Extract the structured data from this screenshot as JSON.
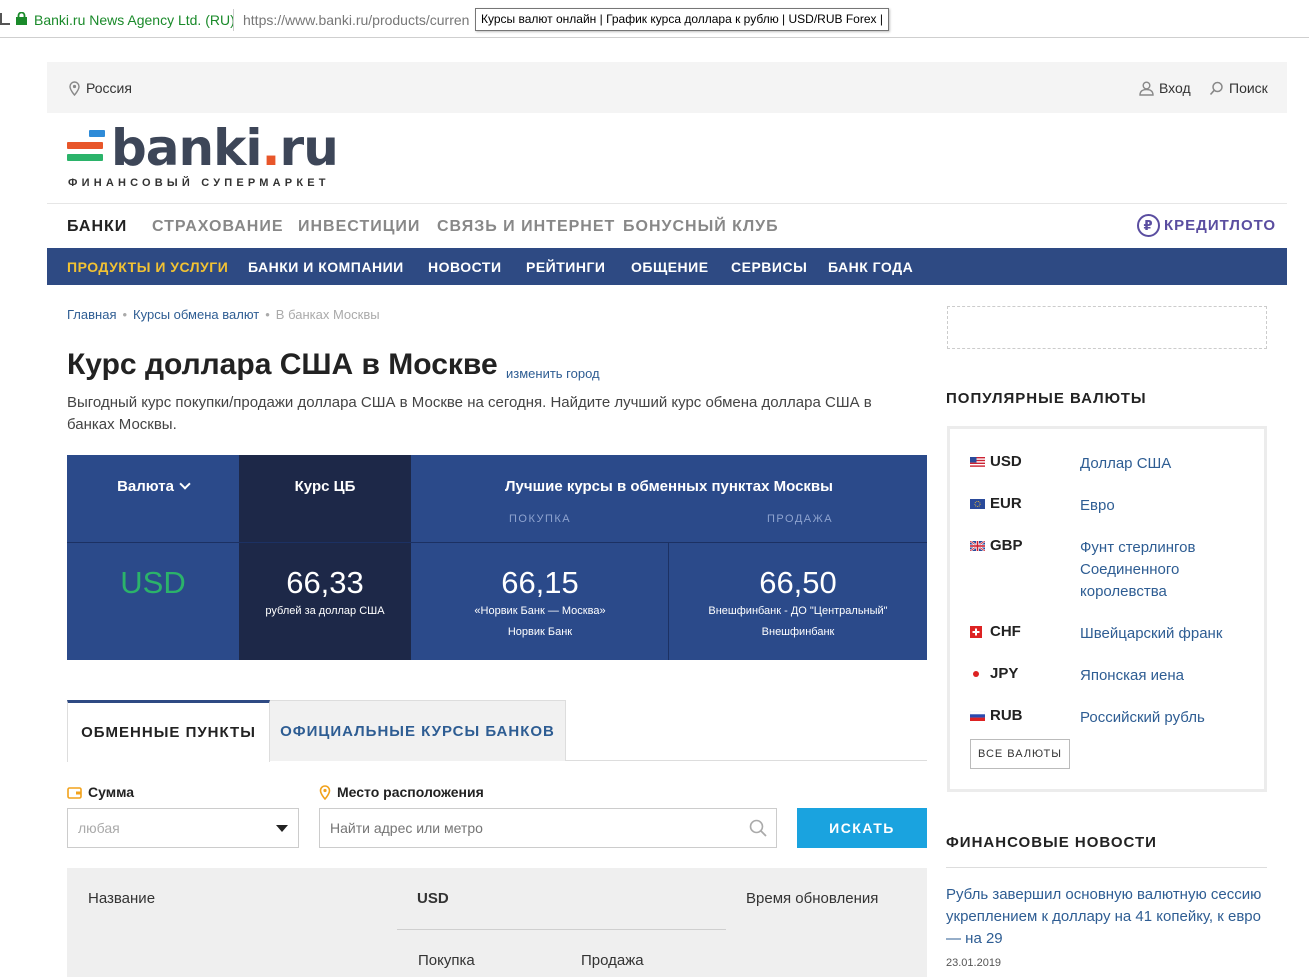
{
  "browser": {
    "site_name": "Banki.ru News Agency Ltd. (RU)",
    "url": "https://www.banki.ru/products/curren",
    "tooltip": "Курсы валют онлайн | График курса доллара к рублю | USD/RUB Forex |"
  },
  "topline": {
    "region": "Россия",
    "login": "Вход",
    "search": "Поиск"
  },
  "logo": {
    "word_main": "banki",
    "word_dot": ".",
    "word_tld": "ru",
    "tagline": "ФИНАНСОВЫЙ СУПЕРМАРКЕТ",
    "colors": [
      "#2e8bd8",
      "#e8562a",
      "#2bb36a"
    ]
  },
  "main_nav": {
    "items": [
      {
        "label": "БАНКИ",
        "active": true
      },
      {
        "label": "СТРАХОВАНИЕ",
        "active": false
      },
      {
        "label": "ИНВЕСТИЦИИ",
        "active": false
      },
      {
        "label": "СВЯЗЬ И ИНТЕРНЕТ",
        "active": false
      },
      {
        "label": "БОНУСНЫЙ КЛУБ",
        "active": false
      }
    ],
    "credit_label": "КРЕДИТЛОТО",
    "credit_icon_glyph": "₽"
  },
  "sub_nav": {
    "items": [
      {
        "label": "ПРОДУКТЫ И УСЛУГИ",
        "active": true
      },
      {
        "label": "БАНКИ И КОМПАНИИ",
        "active": false
      },
      {
        "label": "НОВОСТИ",
        "active": false
      },
      {
        "label": "РЕЙТИНГИ",
        "active": false
      },
      {
        "label": "ОБЩЕНИЕ",
        "active": false
      },
      {
        "label": "СЕРВИСЫ",
        "active": false
      },
      {
        "label": "БАНК ГОДА",
        "active": false
      }
    ],
    "accent_color": "#f2c233",
    "bg_color": "#2e4a83"
  },
  "breadcrumbs": [
    "Главная",
    "Курсы обмена валют",
    "В банках Москвы"
  ],
  "page": {
    "title": "Курс доллара США в Москве",
    "change_city": "изменить город",
    "lead": "Выгодный курс покупки/продажи доллара США в Москве на сегодня. Найдите лучший курс обмена доллара США в банках Москвы."
  },
  "rates": {
    "currency_header": "Валюта",
    "cb_header": "Курс ЦБ",
    "best_header": "Лучшие курсы в обменных пунктах Москвы",
    "buy_label": "ПОКУПКА",
    "sell_label": "ПРОДАЖА",
    "currency": "USD",
    "cb_value": "66,33",
    "cb_note": "рублей за доллар США",
    "buy_value": "66,15",
    "buy_office": "«Норвик Банк — Москва»",
    "buy_bank": "Норвик Банк",
    "sell_value": "66,50",
    "sell_office": "Внешфинбанк - ДО \"Центральный\"",
    "sell_bank": "Внешфинбанк"
  },
  "tabs": [
    {
      "label": "ОБМЕННЫЕ ПУНКТЫ",
      "active": true
    },
    {
      "label": "ОФИЦИАЛЬНЫЕ КУРСЫ БАНКОВ",
      "active": false
    }
  ],
  "filters": {
    "sum_label": "Сумма",
    "sum_value": "любая",
    "location_label": "Место расположения",
    "location_placeholder": "Найти адрес или метро",
    "search_button": "ИСКАТЬ"
  },
  "table": {
    "col_name": "Название",
    "col_currency": "USD",
    "col_updated": "Время обновления",
    "col_buy": "Покупка",
    "col_sell": "Продажа"
  },
  "sidebar": {
    "popular_title": "ПОПУЛЯРНЫЕ ВАЛЮТЫ",
    "currencies": [
      {
        "code": "USD",
        "name": "Доллар США"
      },
      {
        "code": "EUR",
        "name": "Евро"
      },
      {
        "code": "GBP",
        "name": "Фунт стерлингов Соединенного королевства"
      },
      {
        "code": "CHF",
        "name": "Швейцарский франк"
      },
      {
        "code": "JPY",
        "name": "Японская иена"
      },
      {
        "code": "RUB",
        "name": "Российский рубль"
      }
    ],
    "all_button": "ВСЕ ВАЛЮТЫ",
    "news_title": "ФИНАНСОВЫЕ НОВОСТИ",
    "news_item": "Рубль завершил основную валютную сессию укреплением к доллару на 41 копейку, к евро — на 29",
    "news_date": "23.01.2019"
  }
}
